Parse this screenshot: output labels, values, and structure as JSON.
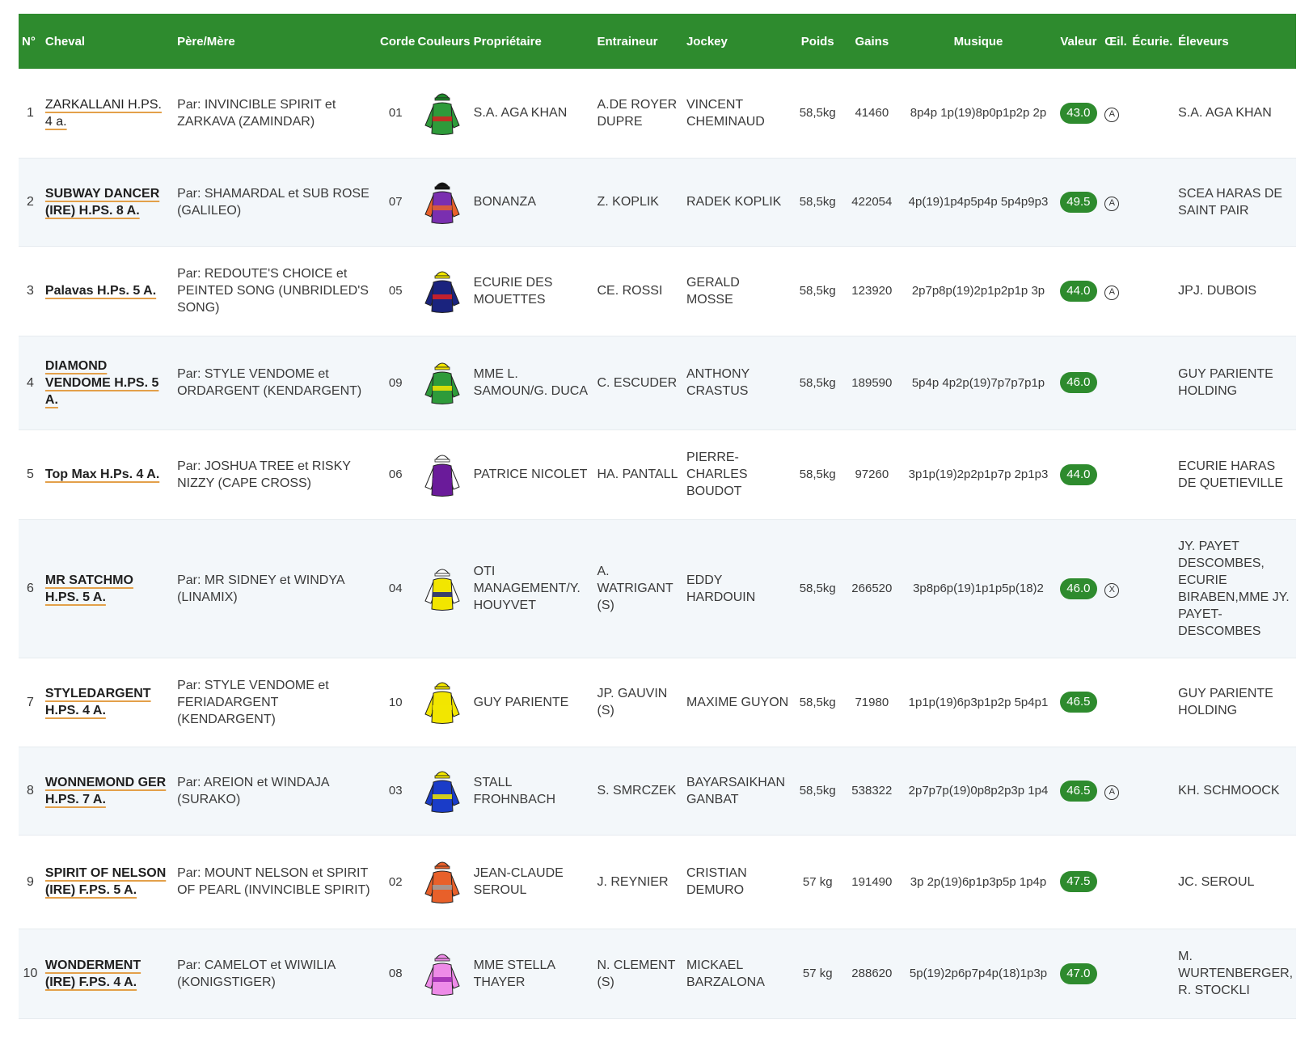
{
  "headers": {
    "num": "N°",
    "horse": "Cheval",
    "parents": "Père/Mère",
    "corde": "Corde",
    "colors": "Couleurs",
    "owner": "Propriétaire",
    "trainer": "Entraineur",
    "jockey": "Jockey",
    "weight": "Poids",
    "gains": "Gains",
    "music": "Musique",
    "value": "Valeur",
    "eye": "Œil.",
    "stable": "Écurie.",
    "breeders": "Éleveurs"
  },
  "rows": [
    {
      "num": "1",
      "horse": "ZARKALLANI H.PS. 4 a.",
      "parents": "Par: INVINCIBLE SPIRIT et ZARKAVA (ZAMINDAR)",
      "corde": "01",
      "owner": "S.A. AGA KHAN",
      "trainer": "A.DE ROYER DUPRE",
      "jockey": "VINCENT CHEMINAUD",
      "weight": "58,5kg",
      "gains": "41460",
      "music": "8p4p 1p(19)8p0p1p2p 2p",
      "value": "43.0",
      "eye": "A",
      "breeders": "S.A. AGA KHAN",
      "silk": {
        "body": "#2e9b3a",
        "sleeves": "#2e9b3a",
        "cap": "#1e8a2a",
        "accent": "#d62020"
      }
    },
    {
      "num": "2",
      "horse": "SUBWAY DANCER (IRE) H.PS. 8 A.",
      "parents": "Par: SHAMARDAL et SUB ROSE (GALILEO)",
      "corde": "07",
      "owner": "BONANZA",
      "trainer": "Z. KOPLIK",
      "jockey": "RADEK KOPLIK",
      "weight": "58,5kg",
      "gains": "422054",
      "music": "4p(19)1p4p5p4p 5p4p9p3",
      "value": "49.5",
      "eye": "A",
      "breeders": "SCEA HARAS DE SAINT PAIR",
      "silk": {
        "body": "#7a2fb0",
        "sleeves": "#e8602a",
        "cap": "#111111",
        "accent": "#e8602a"
      }
    },
    {
      "num": "3",
      "horse": "Palavas H.Ps. 5 A.",
      "parents": "Par: REDOUTE'S CHOICE et PEINTED SONG (UNBRIDLED'S SONG)",
      "corde": "05",
      "owner": "ECURIE DES MOUETTES",
      "trainer": "CE. ROSSI",
      "jockey": "GERALD MOSSE",
      "weight": "58,5kg",
      "gains": "123920",
      "music": "2p7p8p(19)2p1p2p1p 3p",
      "value": "44.0",
      "eye": "A",
      "breeders": "JPJ. DUBOIS",
      "silk": {
        "body": "#1a237e",
        "sleeves": "#1a237e",
        "cap": "#f2e600",
        "accent": "#e02020"
      }
    },
    {
      "num": "4",
      "horse": "DIAMOND VENDOME H.PS. 5 A.",
      "parents": "Par: STYLE VENDOME et ORDARGENT (KENDARGENT)",
      "corde": "09",
      "owner": "MME L. SAMOUN/G. DUCA",
      "trainer": "C. ESCUDER",
      "jockey": "ANTHONY CRASTUS",
      "weight": "58,5kg",
      "gains": "189590",
      "music": "5p4p 4p2p(19)7p7p7p1p",
      "value": "46.0",
      "eye": "",
      "breeders": "GUY PARIENTE HOLDING",
      "silk": {
        "body": "#2e9b3a",
        "sleeves": "#2e9b3a",
        "cap": "#f2e600",
        "accent": "#f2e600"
      }
    },
    {
      "num": "5",
      "horse": "Top Max H.Ps. 4 A.",
      "parents": "Par: JOSHUA TREE et RISKY NIZZY (CAPE CROSS)",
      "corde": "06",
      "owner": "PATRICE NICOLET",
      "trainer": "HA. PANTALL",
      "jockey": "PIERRE-CHARLES BOUDOT",
      "weight": "58,5kg",
      "gains": "97260",
      "music": "3p1p(19)2p2p1p7p 2p1p3",
      "value": "44.0",
      "eye": "",
      "breeders": "ECURIE HARAS DE QUETIEVILLE",
      "silk": {
        "body": "#6a1b9a",
        "sleeves": "#ffffff",
        "cap": "#ffffff",
        "accent": "#6a1b9a"
      }
    },
    {
      "num": "6",
      "horse": "MR SATCHMO H.PS. 5 A.",
      "parents": "Par: MR SIDNEY et WINDYA (LINAMIX)",
      "corde": "04",
      "owner": "OTI MANAGEMENT/Y. HOUYVET",
      "trainer": "A. WATRIGANT (S)",
      "jockey": "EDDY HARDOUIN",
      "weight": "58,5kg",
      "gains": "266520",
      "music": "3p8p6p(19)1p1p5p(18)2",
      "value": "46.0",
      "eye": "X",
      "breeders": "JY. PAYET DESCOMBES, ECURIE BIRABEN,MME JY. PAYET-DESCOMBES",
      "silk": {
        "body": "#f2e600",
        "sleeves": "#ffffff",
        "cap": "#ffffff",
        "accent": "#1a237e"
      }
    },
    {
      "num": "7",
      "horse": "STYLEDARGENT H.PS. 4 A.",
      "parents": "Par: STYLE VENDOME et FERIADARGENT (KENDARGENT)",
      "corde": "10",
      "owner": "GUY PARIENTE",
      "trainer": "JP. GAUVIN (S)",
      "jockey": "MAXIME GUYON",
      "weight": "58,5kg",
      "gains": "71980",
      "music": "1p1p(19)6p3p1p2p 5p4p1",
      "value": "46.5",
      "eye": "",
      "breeders": "GUY PARIENTE HOLDING",
      "silk": {
        "body": "#f2e600",
        "sleeves": "#f2e600",
        "cap": "#f2e600",
        "accent": "#f2e600"
      }
    },
    {
      "num": "8",
      "horse": "WONNEMOND GER H.PS. 7 A.",
      "parents": "Par: AREION et WINDAJA (SURAKO)",
      "corde": "03",
      "owner": "STALL FROHNBACH",
      "trainer": "S. SMRCZEK",
      "jockey": "BAYARSAIKHAN GANBAT",
      "weight": "58,5kg",
      "gains": "538322",
      "music": "2p7p7p(19)0p8p2p3p 1p4",
      "value": "46.5",
      "eye": "A",
      "breeders": "KH. SCHMOOCK",
      "silk": {
        "body": "#1a3cc8",
        "sleeves": "#1a3cc8",
        "cap": "#f2e600",
        "accent": "#f2e600"
      }
    },
    {
      "num": "9",
      "horse": "SPIRIT OF NELSON (IRE) F.PS. 5 A.",
      "parents": "Par: MOUNT NELSON et SPIRIT OF PEARL (INVINCIBLE SPIRIT)",
      "corde": "02",
      "owner": "JEAN-CLAUDE SEROUL",
      "trainer": "J. REYNIER",
      "jockey": "CRISTIAN DEMURO",
      "weight": "57 kg",
      "gains": "191490",
      "music": "3p 2p(19)6p1p3p5p 1p4p",
      "value": "47.5",
      "eye": "",
      "breeders": "JC. SEROUL",
      "silk": {
        "body": "#e8602a",
        "sleeves": "#e8602a",
        "cap": "#e8602a",
        "accent": "#9e9e9e"
      }
    },
    {
      "num": "10",
      "horse": "WONDERMENT (IRE) F.PS. 4 A.",
      "parents": "Par: CAMELOT et WIWILIA (KONIGSTIGER)",
      "corde": "08",
      "owner": "MME STELLA THAYER",
      "trainer": "N. CLEMENT (S)",
      "jockey": "MICKAEL BARZALONA",
      "weight": "57 kg",
      "gains": "288620",
      "music": "5p(19)2p6p7p4p(18)1p3p",
      "value": "47.0",
      "eye": "",
      "breeders": "M. WURTENBERGER, R. STOCKLI",
      "silk": {
        "body": "#ee8be8",
        "sleeves": "#ee8be8",
        "cap": "#ee8be8",
        "accent": "#9c27b0"
      }
    }
  ]
}
